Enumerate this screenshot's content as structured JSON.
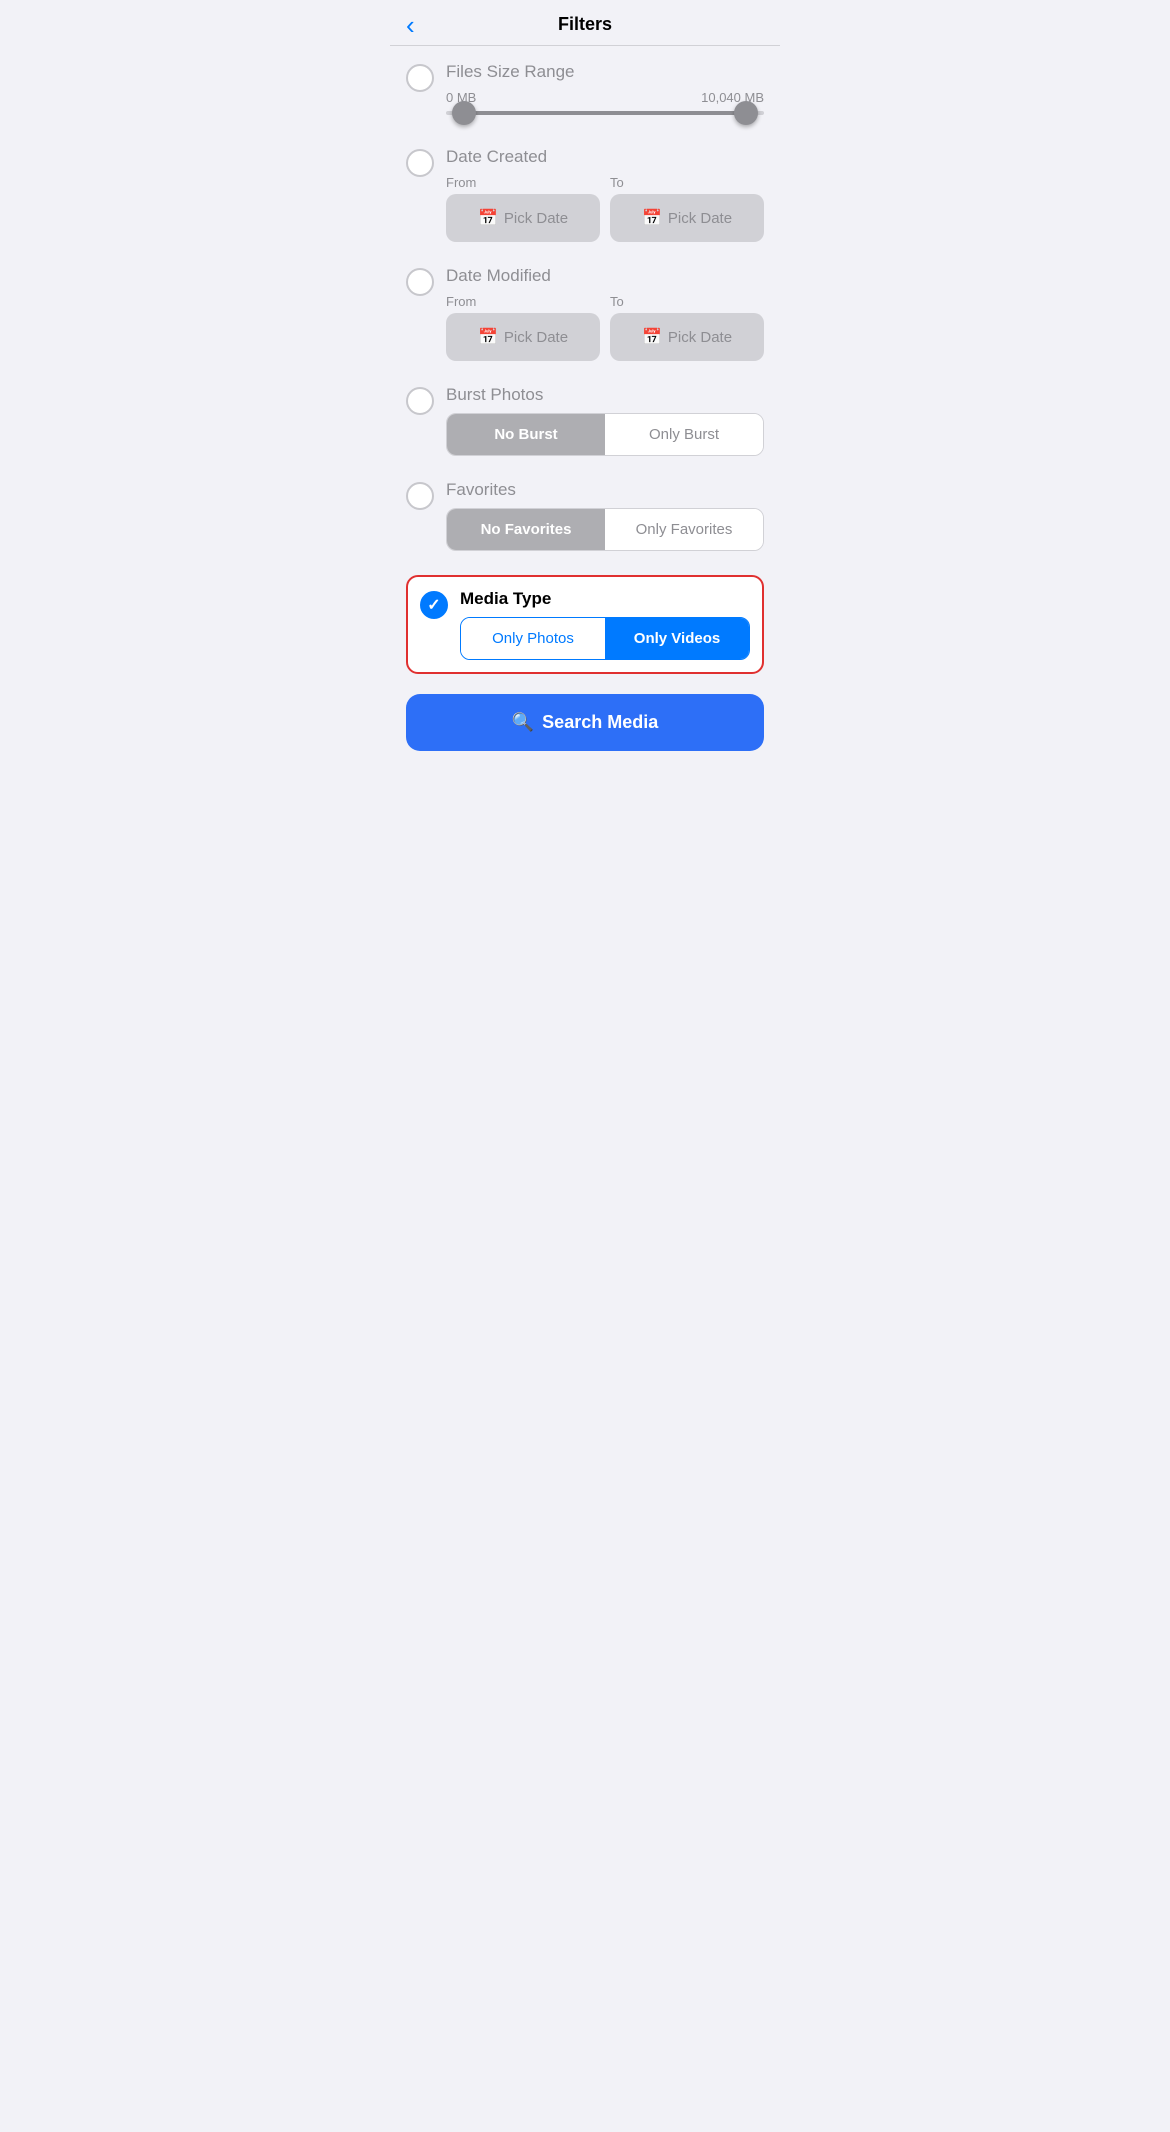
{
  "header": {
    "title": "Filters",
    "back_label": "<"
  },
  "sections": {
    "file_size": {
      "label": "Files Size Range",
      "min_label": "0 MB",
      "max_label": "10,040 MB"
    },
    "date_created": {
      "label": "Date Created",
      "from_label": "From",
      "to_label": "To",
      "pick_date": "Pick Date"
    },
    "date_modified": {
      "label": "Date Modified",
      "from_label": "From",
      "to_label": "To",
      "pick_date": "Pick Date"
    },
    "burst_photos": {
      "label": "Burst Photos",
      "option_no": "No Burst",
      "option_only": "Only Burst"
    },
    "favorites": {
      "label": "Favorites",
      "option_no": "No Favorites",
      "option_only": "Only Favorites"
    },
    "media_type": {
      "label": "Media Type",
      "option_photos": "Only Photos",
      "option_videos": "Only Videos"
    }
  },
  "search_button": {
    "label": "Search Media"
  },
  "colors": {
    "blue": "#007aff",
    "red_border": "#e03030",
    "active_toggle": "#aeaeb2",
    "search_btn": "#2d6ff7"
  }
}
